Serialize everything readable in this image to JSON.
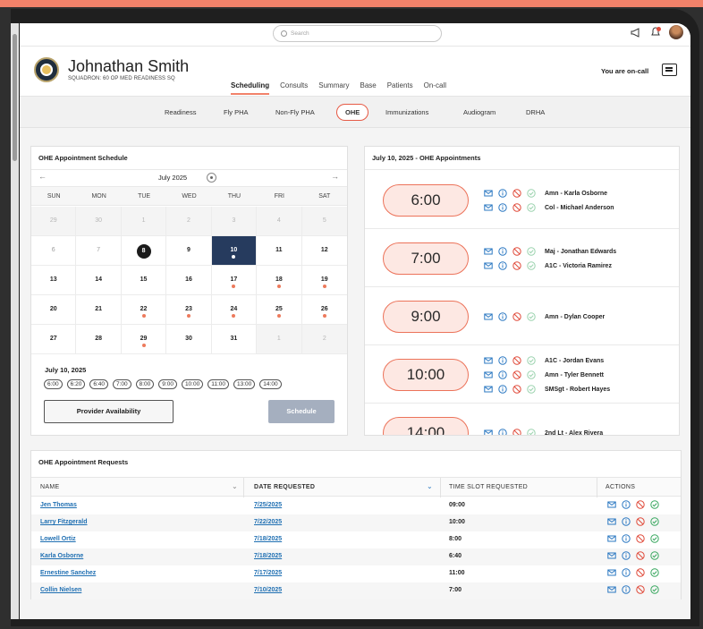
{
  "topbar": {
    "search_placeholder": "Search"
  },
  "header": {
    "name": "Johnathan Smith",
    "squadron": "SQUADRON: 60 OP MED READINESS SQ",
    "tabs": [
      "Scheduling",
      "Consults",
      "Summary",
      "Base",
      "Patients",
      "On-call"
    ],
    "active_tab": "Scheduling",
    "oncall_text": "You are on-call"
  },
  "sub_tabs": [
    "Readiness",
    "Fly PHA",
    "Non-Fly PHA",
    "OHE",
    "Immunizations",
    "Audiogram",
    "DRHA"
  ],
  "active_sub_tab": "OHE",
  "calendar": {
    "title": "OHE Appointment Schedule",
    "month_label": "July 2025",
    "weekdays": [
      "SUN",
      "MON",
      "TUE",
      "WED",
      "THU",
      "FRI",
      "SAT"
    ],
    "days": [
      {
        "n": "29",
        "s": "out"
      },
      {
        "n": "30",
        "s": "out"
      },
      {
        "n": "1",
        "s": "out"
      },
      {
        "n": "2",
        "s": "out"
      },
      {
        "n": "3",
        "s": "out"
      },
      {
        "n": "4",
        "s": "out"
      },
      {
        "n": "5",
        "s": "out"
      },
      {
        "n": "6",
        "s": "past"
      },
      {
        "n": "7",
        "s": "past"
      },
      {
        "n": "8",
        "s": "today"
      },
      {
        "n": "9",
        "s": ""
      },
      {
        "n": "10",
        "s": "selected",
        "dot": true
      },
      {
        "n": "11",
        "s": ""
      },
      {
        "n": "12",
        "s": ""
      },
      {
        "n": "13",
        "s": ""
      },
      {
        "n": "14",
        "s": ""
      },
      {
        "n": "15",
        "s": ""
      },
      {
        "n": "16",
        "s": ""
      },
      {
        "n": "17",
        "s": "",
        "dot": true
      },
      {
        "n": "18",
        "s": "",
        "dot": true
      },
      {
        "n": "19",
        "s": "",
        "dot": true
      },
      {
        "n": "20",
        "s": ""
      },
      {
        "n": "21",
        "s": ""
      },
      {
        "n": "22",
        "s": "",
        "dot": true
      },
      {
        "n": "23",
        "s": "",
        "dot": true
      },
      {
        "n": "24",
        "s": "",
        "dot": true
      },
      {
        "n": "25",
        "s": "",
        "dot": true
      },
      {
        "n": "26",
        "s": "",
        "dot": true
      },
      {
        "n": "27",
        "s": ""
      },
      {
        "n": "28",
        "s": ""
      },
      {
        "n": "29",
        "s": "",
        "dot": true
      },
      {
        "n": "30",
        "s": ""
      },
      {
        "n": "31",
        "s": ""
      },
      {
        "n": "1",
        "s": "out"
      },
      {
        "n": "2",
        "s": "out"
      }
    ],
    "selected_date_label": "July 10, 2025",
    "time_slots": [
      "6:00",
      "6:20",
      "6:40",
      "7:00",
      "8:00",
      "9:00",
      "10:00",
      "11:00",
      "13:00",
      "14:00"
    ],
    "provider_button": "Provider Availability",
    "schedule_button": "Schedule"
  },
  "appointments": {
    "title": "July 10, 2025 - OHE Appointments",
    "groups": [
      {
        "time": "6:00",
        "people": [
          "Amn - Karla Osborne",
          "Col - Michael Anderson"
        ]
      },
      {
        "time": "7:00",
        "people": [
          "Maj - Jonathan Edwards",
          "A1C - Victoria Ramirez"
        ]
      },
      {
        "time": "9:00",
        "people": [
          "Amn - Dylan Cooper"
        ]
      },
      {
        "time": "10:00",
        "people": [
          "A1C - Jordan Evans",
          "Amn - Tyler Bennett",
          "SMSgt - Robert Hayes"
        ]
      },
      {
        "time": "14:00",
        "people": [
          "2nd Lt - Alex Rivera"
        ]
      }
    ]
  },
  "requests": {
    "title": "OHE Appointment Requests",
    "columns": [
      "NAME",
      "DATE REQUESTED",
      "TIME SLOT REQUESTED",
      "ACTIONS"
    ],
    "rows": [
      {
        "name": "Jen Thomas",
        "date": "7/25/2025",
        "slot": "09:00"
      },
      {
        "name": "Larry Fitzgerald",
        "date": "7/22/2025",
        "slot": "10:00"
      },
      {
        "name": "Lowell Ortiz",
        "date": "7/18/2025",
        "slot": "8:00"
      },
      {
        "name": "Karla Osborne",
        "date": "7/18/2025",
        "slot": "6:40"
      },
      {
        "name": "Ernestine Sanchez",
        "date": "7/17/2025",
        "slot": "11:00"
      },
      {
        "name": "Collin Nielsen",
        "date": "7/10/2025",
        "slot": "7:00"
      }
    ]
  },
  "colors": {
    "accent": "#f2826a",
    "selected_day": "#263b5e",
    "link": "#1f6fb2",
    "icon_blue": "#2b78c2",
    "icon_red": "#e04a3a",
    "icon_green": "#3aa860"
  }
}
